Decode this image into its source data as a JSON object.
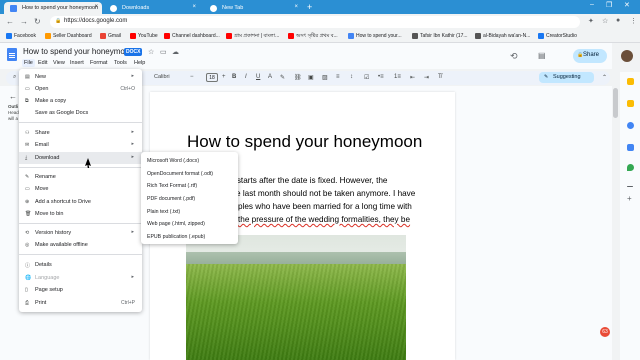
{
  "browser": {
    "tabs": [
      {
        "title": "How to spend your honeymoon",
        "active": true,
        "color": "#4285f4"
      },
      {
        "title": "Downloads",
        "active": false,
        "color": "#ffffff"
      },
      {
        "title": "New Tab",
        "active": false,
        "color": "#ffffff"
      }
    ],
    "url": "https://docs.google.com",
    "tab_close": "×",
    "new_tab": "+"
  },
  "bookmarks": [
    {
      "label": "Facebook",
      "color": "#1877f2"
    },
    {
      "label": "Seller Dashboard",
      "color": "#ff9900"
    },
    {
      "label": "Gmail",
      "color": "#ea4335"
    },
    {
      "label": "YouTube",
      "color": "#ff0000"
    },
    {
      "label": "Channel dashboard...",
      "color": "#ff0000"
    },
    {
      "label": "গ্রাম প্রকাশনা | বাংলা...",
      "color": "#ff0000"
    },
    {
      "label": "অসৎ সৃষ্টির প্রথম ব...",
      "color": "#ff0000"
    },
    {
      "label": "How to spend your...",
      "color": "#4285f4"
    },
    {
      "label": "Tafsir Ibn Kathir (17...",
      "color": "#555555"
    },
    {
      "label": "al-Bidayah wa'an-N...",
      "color": "#555555"
    },
    {
      "label": "CreatorStudio",
      "color": "#1877f2"
    }
  ],
  "doc": {
    "title": "How to spend your honeymoon",
    "badge": "DOCX",
    "share_label": "Share",
    "suggesting_label": "Suggesting",
    "menus": [
      "File",
      "Edit",
      "View",
      "Insert",
      "Format",
      "Tools",
      "Help"
    ],
    "font": "Calibri",
    "font_size": "18",
    "heading": "How to spend your honeymoon",
    "body_lines": [
      "n starts after the date is fixed. However, the",
      "e last month should not be taken anymore. I have",
      "ples who have been married for a long time with",
      "the pressure of the wedding formalities, they be"
    ],
    "outline_label": "Outli",
    "outline_text": [
      "Head",
      "will a"
    ],
    "notification_count": "63"
  },
  "file_menu": {
    "items": [
      {
        "label": "New",
        "icon": "new-doc-icon",
        "arrow": true
      },
      {
        "label": "Open",
        "shortcut": "Ctrl+O",
        "icon": "folder-icon"
      },
      {
        "label": "Make a copy",
        "icon": "copy-icon"
      },
      {
        "label": "Save as Google Docs",
        "icon": ""
      },
      {
        "label": "Share",
        "icon": "share-icon",
        "arrow": true
      },
      {
        "label": "Email",
        "icon": "email-icon",
        "arrow": true
      },
      {
        "label": "Download",
        "icon": "download-icon",
        "arrow": true,
        "highlighted": true
      },
      {
        "label": "Rename",
        "icon": "rename-icon"
      },
      {
        "label": "Move",
        "icon": "move-icon"
      },
      {
        "label": "Add a shortcut to Drive",
        "icon": "shortcut-icon"
      },
      {
        "label": "Move to bin",
        "icon": "bin-icon"
      },
      {
        "label": "Version history",
        "icon": "history-icon",
        "arrow": true
      },
      {
        "label": "Make available offline",
        "icon": "offline-icon"
      },
      {
        "label": "Details",
        "icon": "info-icon"
      },
      {
        "label": "Language",
        "icon": "language-icon",
        "arrow": true,
        "disabled": true
      },
      {
        "label": "Page setup",
        "icon": "page-setup-icon"
      },
      {
        "label": "Print",
        "shortcut": "Ctrl+P",
        "icon": "print-icon"
      }
    ]
  },
  "download_menu": {
    "items": [
      "Microsoft Word (.docx)",
      "OpenDocument format (.odt)",
      "Rich Text Format (.rtf)",
      "PDF document (.pdf)",
      "Plain text (.txt)",
      "Web page (.html, zipped)",
      "EPUB publication (.epub)"
    ]
  }
}
